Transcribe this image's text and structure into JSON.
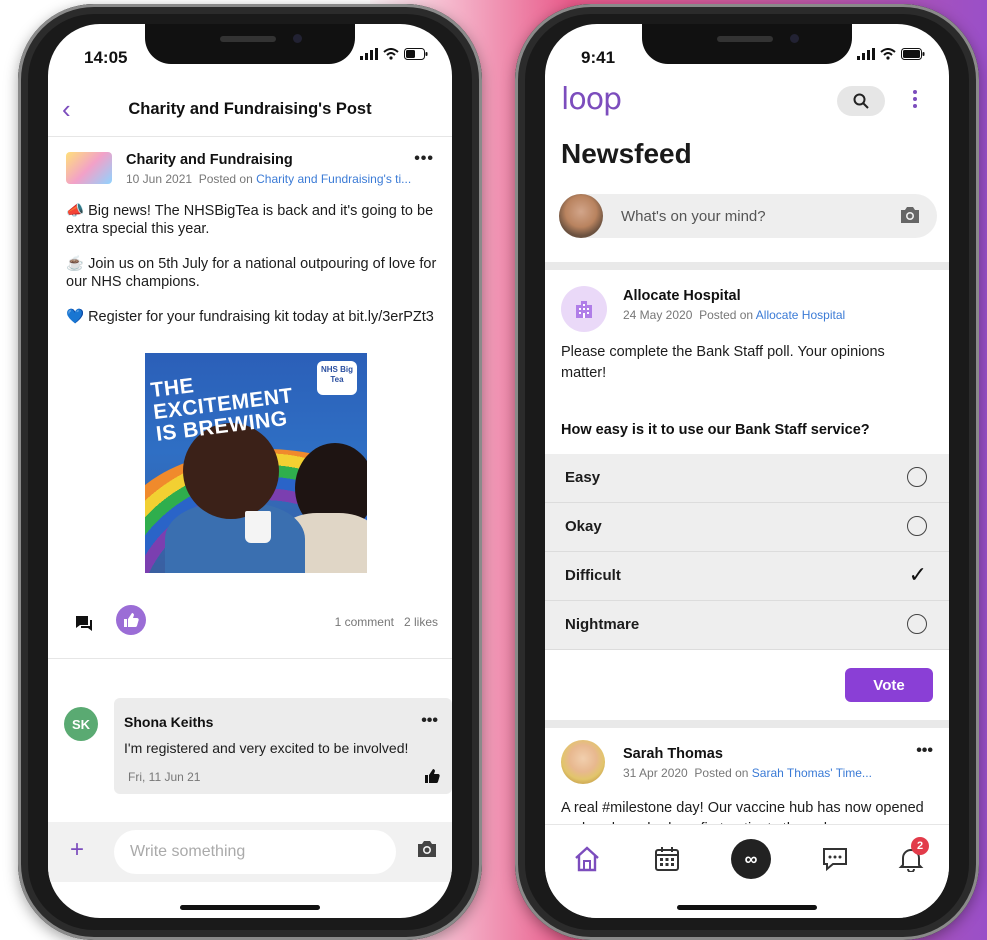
{
  "left_phone": {
    "status_time": "14:05",
    "header": {
      "title": "Charity and Fundraising's Post"
    },
    "post": {
      "author": "Charity and Fundraising",
      "date": "10 Jun 2021",
      "posted_on_label": "Posted on",
      "posted_on_link": "Charity and Fundraising's ti...",
      "paragraphs": [
        "📣 Big news! The NHSBigTea is back and it's going to be extra special this year.",
        "☕ Join us on 5th July for a national outpouring of love for our NHS champions.",
        "💙 Register for your fundraising kit today at bit.ly/3erPZt3"
      ],
      "image_text": "THE EXCITEMENT IS BREWING",
      "image_badge": "NHS Big Tea",
      "counts": {
        "comments": "1 comment",
        "likes": "2 likes"
      }
    },
    "comment": {
      "initials": "SK",
      "name": "Shona Keiths",
      "text": "I'm registered and very excited to be involved!",
      "date": "Fri, 11 Jun 21"
    },
    "composer": {
      "placeholder": "Write something"
    }
  },
  "right_phone": {
    "status_time": "9:41",
    "logo": "loop",
    "title": "Newsfeed",
    "mind_placeholder": "What's on your mind?",
    "post": {
      "author": "Allocate Hospital",
      "date": "24 May 2020",
      "posted_on_label": "Posted on",
      "posted_on_link": "Allocate Hospital",
      "body": "Please complete the Bank Staff poll. Your opinions matter!",
      "poll_question": "How easy is it to use our Bank Staff service?",
      "options": [
        {
          "label": "Easy",
          "selected": false
        },
        {
          "label": "Okay",
          "selected": false
        },
        {
          "label": "Difficult",
          "selected": true
        },
        {
          "label": "Nightmare",
          "selected": false
        }
      ],
      "vote_label": "Vote"
    },
    "post2": {
      "author": "Sarah Thomas",
      "date": "31 Apr 2020",
      "posted_on_label": "Posted on",
      "posted_on_link": "Sarah Thomas' Time...",
      "body": "A real #milestone day! Our vaccine hub has now opened and we have had our first patients through"
    },
    "tabbar": {
      "center_label": "∞",
      "notification_count": "2"
    }
  },
  "colors": {
    "accent": "#7c4dbd",
    "vote": "#8a3fd6",
    "link": "#3b7bd6"
  }
}
